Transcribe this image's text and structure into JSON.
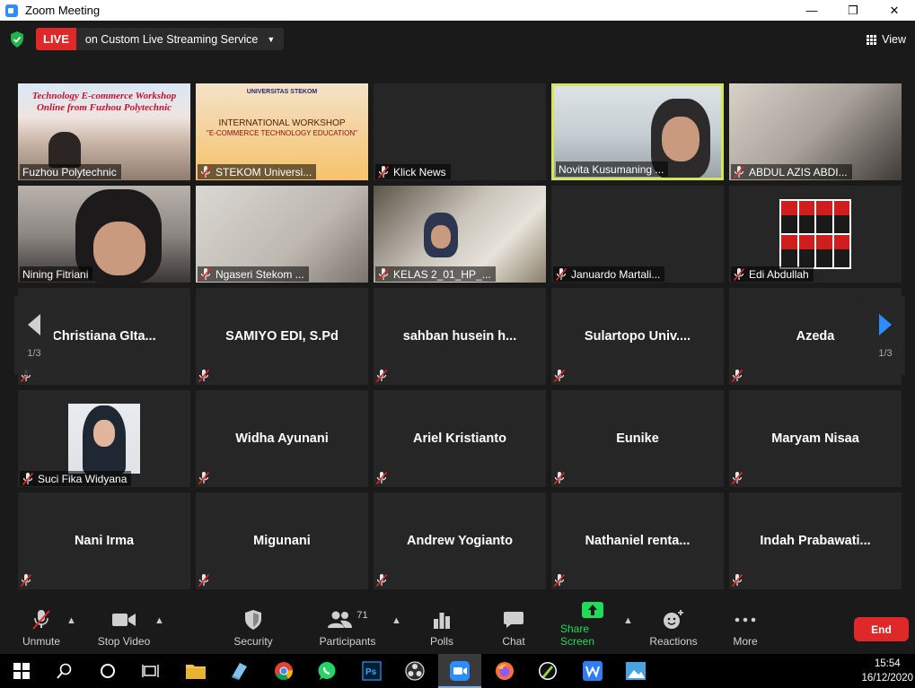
{
  "window": {
    "title": "Zoom Meeting",
    "minimize": "—",
    "maximize": "❐",
    "close": "✕"
  },
  "topbar": {
    "live_badge": "LIVE",
    "live_label": "on Custom Live Streaming Service",
    "view_label": "View"
  },
  "pagination": {
    "left": "1/3",
    "right": "1/3"
  },
  "tiles": [
    {
      "name": "Fuzhou Polytechnic",
      "muted": false,
      "video": true
    },
    {
      "name": "STEKOM Universi...",
      "muted": true,
      "video": true
    },
    {
      "name": "Klick News",
      "muted": true,
      "video": false
    },
    {
      "name": "Novita Kusumaning ...",
      "muted": false,
      "video": true,
      "active": true
    },
    {
      "name": "ABDUL AZIS ABDI...",
      "muted": true,
      "video": true
    },
    {
      "name": "Nining Fitriani",
      "muted": false,
      "video": true
    },
    {
      "name": "Ngaseri Stekom ...",
      "muted": true,
      "video": true
    },
    {
      "name": "KELAS 2_01_HP_...",
      "muted": true,
      "video": true
    },
    {
      "name": "Januardo Martali...",
      "muted": true,
      "video": false
    },
    {
      "name": "Edi Abdullah",
      "muted": true,
      "video": false
    },
    {
      "name": "Christiana  GIta...",
      "muted": true,
      "video": false
    },
    {
      "name": "SAMIYO EDI, S.Pd",
      "muted": true,
      "video": false
    },
    {
      "name": "sahban  husein  h...",
      "muted": true,
      "video": false
    },
    {
      "name": "Sulartopo  Univ....",
      "muted": true,
      "video": false
    },
    {
      "name": "Azeda",
      "muted": true,
      "video": false
    },
    {
      "name": "Suci Fika Widyana",
      "muted": true,
      "video": false
    },
    {
      "name": "Widha Ayunani",
      "muted": true,
      "video": false
    },
    {
      "name": "Ariel Kristianto",
      "muted": true,
      "video": false
    },
    {
      "name": "Eunike",
      "muted": true,
      "video": false
    },
    {
      "name": "Maryam Nisaa",
      "muted": true,
      "video": false
    },
    {
      "name": "Nani Irma",
      "muted": true,
      "video": false
    },
    {
      "name": "Migunani",
      "muted": true,
      "video": false
    },
    {
      "name": "Andrew Yogianto",
      "muted": true,
      "video": false
    },
    {
      "name": "Nathaniel  renta...",
      "muted": true,
      "video": false
    },
    {
      "name": "Indah  Prabawati...",
      "muted": true,
      "video": false
    }
  ],
  "slides": {
    "fuzhou_line1": "Technology E-commerce Workshop",
    "fuzhou_line2": "Online from Fuzhou Polytechnic",
    "stekom_title": "INTERNATIONAL WORKSHOP",
    "stekom_sub": "\"E-COMMERCE TECHNOLOGY EDUCATION\"",
    "stekom_uni": "UNIVERSITAS STEKOM"
  },
  "toolbar": {
    "unmute": "Unmute",
    "stop_video": "Stop Video",
    "security": "Security",
    "participants": "Participants",
    "participants_count": "71",
    "polls": "Polls",
    "chat": "Chat",
    "share_screen": "Share Screen",
    "reactions": "Reactions",
    "more": "More",
    "end": "End"
  },
  "taskbar": {
    "time": "15:54",
    "date": "16/12/2020"
  },
  "colors": {
    "live": "#e02828",
    "share": "#23d959",
    "active_border": "#d4e55c",
    "zoom_blue": "#2d8cff"
  }
}
